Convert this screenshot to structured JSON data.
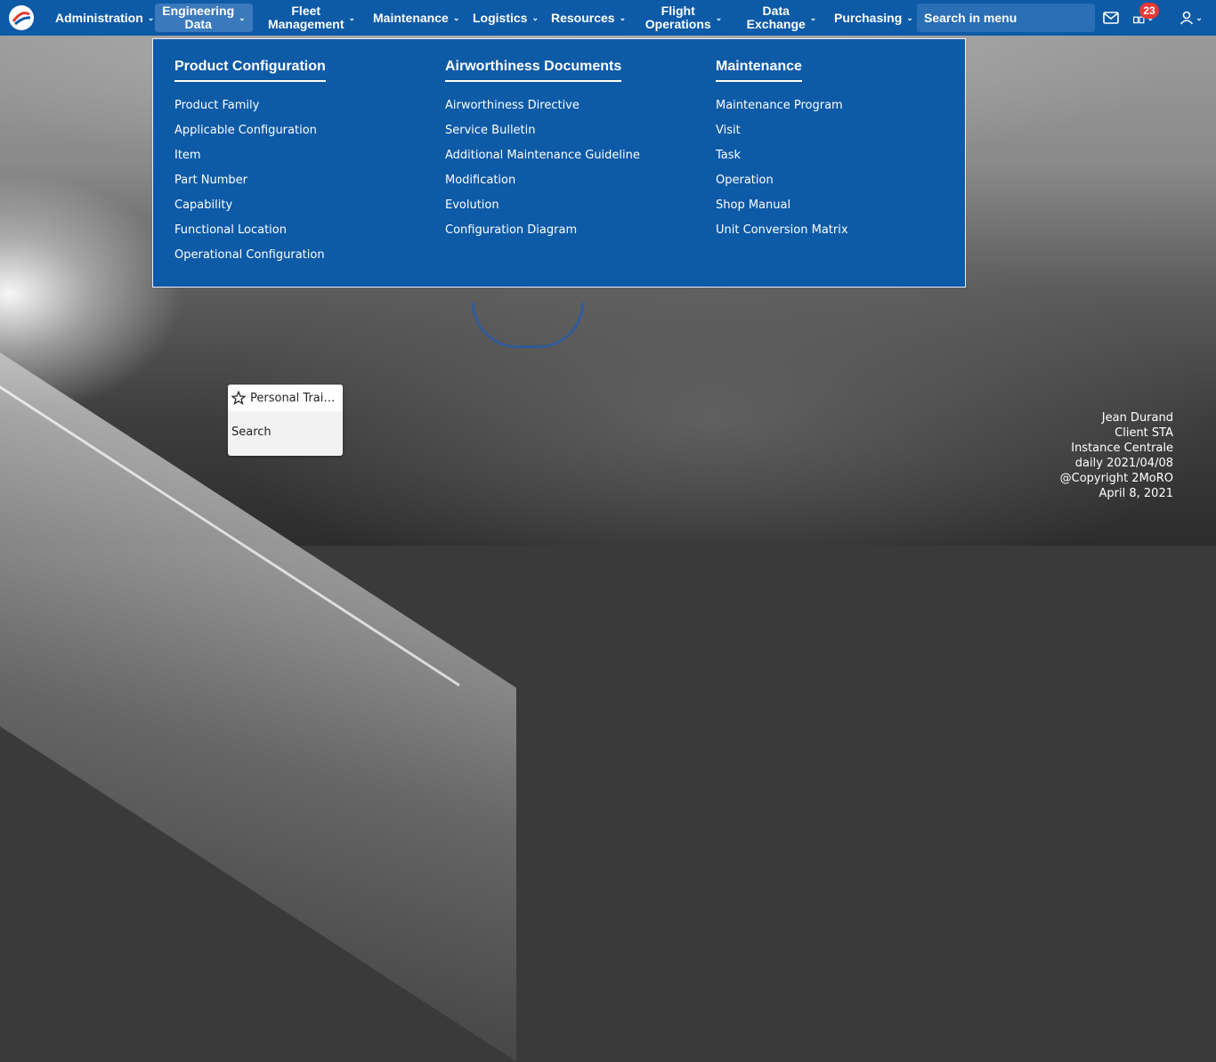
{
  "nav": {
    "items": [
      {
        "label": "Administration"
      },
      {
        "label": "Engineering\nData"
      },
      {
        "label": "Fleet\nManagement"
      },
      {
        "label": "Maintenance"
      },
      {
        "label": "Logistics"
      },
      {
        "label": "Resources"
      },
      {
        "label": "Flight\nOperations"
      },
      {
        "label": "Data\nExchange"
      },
      {
        "label": "Purchasing"
      }
    ],
    "search_placeholder": "Search in menu",
    "notification_count": "23",
    "colors": {
      "bar": "#0d5aa7",
      "active": "#3b79bd",
      "badge": "#e53935"
    }
  },
  "mega_menu": {
    "columns": [
      {
        "title": "Product Configuration",
        "items": [
          "Product Family",
          "Applicable Configuration",
          "Item",
          "Part Number",
          "Capability",
          "Functional Location",
          "Operational Configuration"
        ]
      },
      {
        "title": "Airworthiness Documents",
        "items": [
          "Airworthiness Directive",
          "Service Bulletin",
          "Additional Maintenance Guideline",
          "Modification",
          "Evolution",
          "Configuration Diagram"
        ]
      },
      {
        "title": "Maintenance",
        "items": [
          "Maintenance Program",
          "Visit",
          "Task",
          "Operation",
          "Shop Manual",
          "Unit Conversion Matrix"
        ]
      }
    ]
  },
  "favorites": {
    "item_label": "Personal Traini...",
    "search_label": "Search"
  },
  "info": {
    "lines": [
      "Jean Durand",
      "Client STA",
      "Instance Centrale",
      "daily 2021/04/08",
      "@Copyright 2MoRO",
      "April 8, 2021"
    ]
  }
}
